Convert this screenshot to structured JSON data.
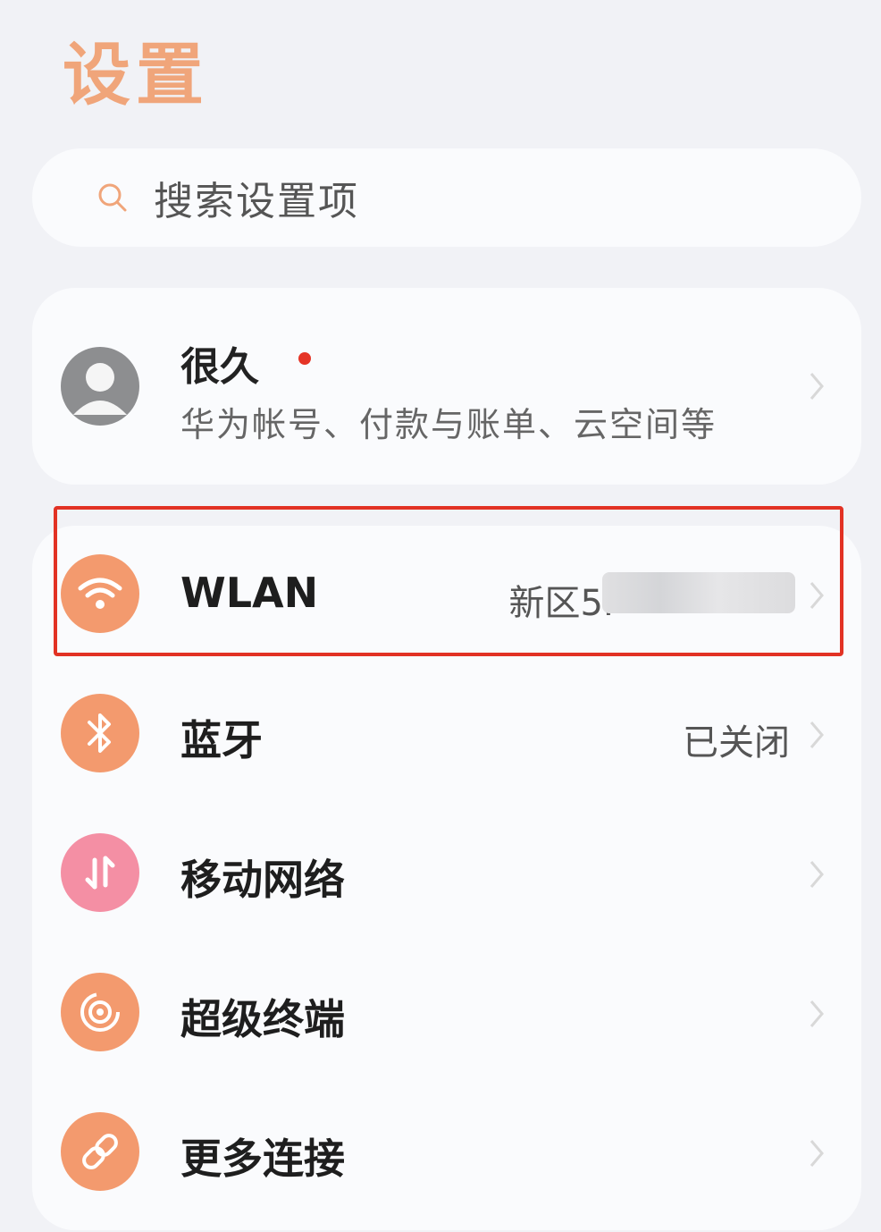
{
  "header": {
    "title": "设置"
  },
  "search": {
    "placeholder": "搜索设置项"
  },
  "account": {
    "name": "很久",
    "subtitle": "华为帐号、付款与账单、云空间等"
  },
  "settings": [
    {
      "label": "WLAN",
      "value": "新区5F",
      "icon": "wifi-icon",
      "color": "#f39a6e"
    },
    {
      "label": "蓝牙",
      "value": "已关闭",
      "icon": "bluetooth-icon",
      "color": "#f39a6e"
    },
    {
      "label": "移动网络",
      "value": "",
      "icon": "mobile-data-icon",
      "color": "#f48fa4"
    },
    {
      "label": "超级终端",
      "value": "",
      "icon": "super-device-icon",
      "color": "#f39a6e"
    },
    {
      "label": "更多连接",
      "value": "",
      "icon": "link-icon",
      "color": "#f39a6e"
    }
  ],
  "colors": {
    "accent": "#f0a57a",
    "highlight": "#e23224",
    "notification": "#e53426"
  }
}
